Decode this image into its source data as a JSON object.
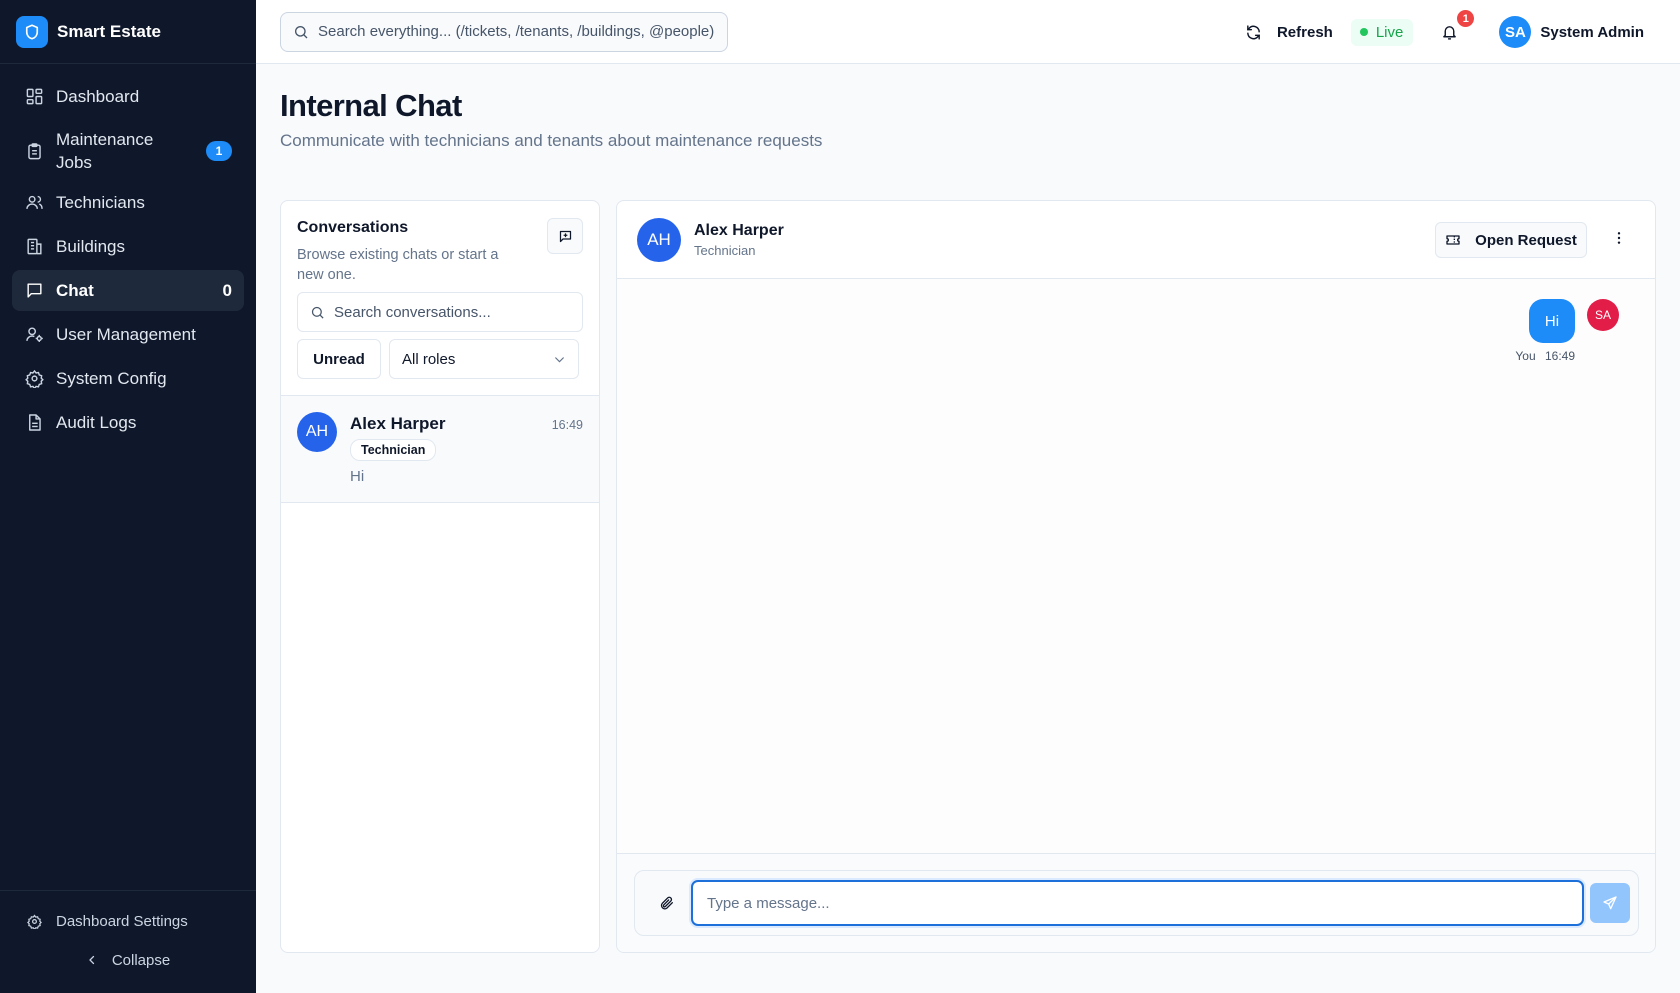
{
  "brand": {
    "name": "Smart Estate"
  },
  "sidebar": {
    "items": [
      {
        "label": "Dashboard",
        "icon": "dashboard-icon"
      },
      {
        "label": "Maintenance Jobs",
        "icon": "clipboard-icon",
        "badge": "1"
      },
      {
        "label": "Technicians",
        "icon": "users-icon"
      },
      {
        "label": "Buildings",
        "icon": "building-icon"
      },
      {
        "label": "Chat",
        "icon": "message-icon",
        "count": "0",
        "active": true
      },
      {
        "label": "User Management",
        "icon": "user-cog-icon"
      },
      {
        "label": "System Config",
        "icon": "gear-icon"
      },
      {
        "label": "Audit Logs",
        "icon": "file-text-icon"
      }
    ],
    "settings_label": "Dashboard Settings",
    "collapse_label": "Collapse"
  },
  "topbar": {
    "search_placeholder": "Search everything... (/tickets, /tenants, /buildings, @people)",
    "refresh_label": "Refresh",
    "live_label": "Live",
    "notifications_count": "1",
    "user_initials": "SA",
    "user_name": "System Admin"
  },
  "page": {
    "title": "Internal Chat",
    "subtitle": "Communicate with technicians and tenants about maintenance requests"
  },
  "conversations": {
    "title": "Conversations",
    "description": "Browse existing chats or start a new one.",
    "search_placeholder": "Search conversations...",
    "unread_label": "Unread",
    "role_filter": "All roles",
    "items": [
      {
        "initials": "AH",
        "name": "Alex Harper",
        "role": "Technician",
        "last_message": "Hi",
        "time": "16:49"
      }
    ]
  },
  "chat": {
    "contact_initials": "AH",
    "contact_name": "Alex Harper",
    "contact_role": "Technician",
    "open_request_label": "Open Request",
    "messages": [
      {
        "text": "Hi",
        "sender": "You",
        "time": "16:49",
        "avatar": "SA"
      }
    ],
    "input_placeholder": "Type a message..."
  },
  "colors": {
    "sidebar_bg": "#0f172a",
    "accent": "#1d8cf8",
    "avatar_blue": "#2563eb",
    "self_avatar": "#e11d48",
    "live_green": "#22c55e",
    "alert_red": "#ef4444"
  }
}
